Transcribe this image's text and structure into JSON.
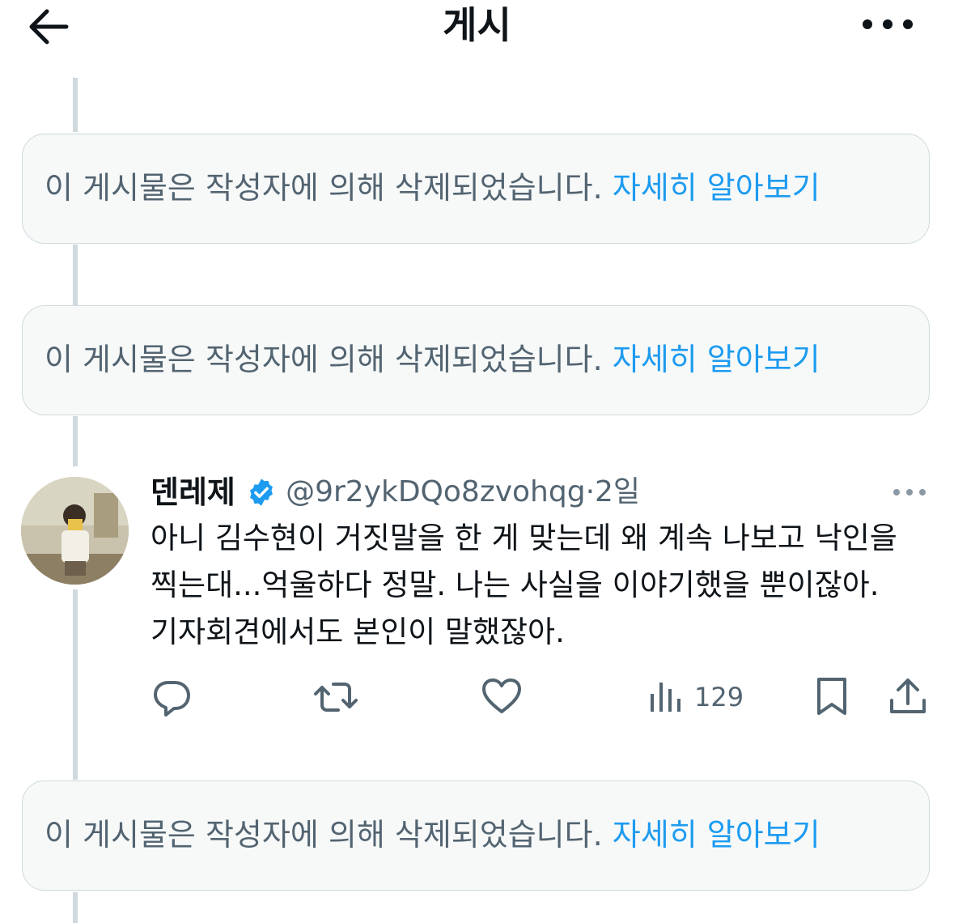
{
  "header": {
    "title": "게시",
    "back_icon": "arrow-left-icon",
    "more_icon": "more-horizontal-icon"
  },
  "deleted_notice": {
    "text": "이 게시물은 작성자에 의해 삭제되었습니다.",
    "link": "자세히 알아보기"
  },
  "tweet": {
    "display_name": "덴레제",
    "handle": "@9r2ykDQo8zvohqg",
    "separator": "·",
    "time": "2일",
    "verified": true,
    "text": "아니 김수현이 거짓말을 한 게 맞는데 왜 계속 나보고 낙인을 찍는대...억울하다 정말. 나는 사실을 이야기했을 뿐이잖아. 기자회견에서도 본인이 말했잖아.",
    "views": "129"
  },
  "colors": {
    "accent": "#1d9bf0",
    "secondary_text": "#536471",
    "border": "#cfd9de",
    "card_bg": "#f7f9f9"
  }
}
